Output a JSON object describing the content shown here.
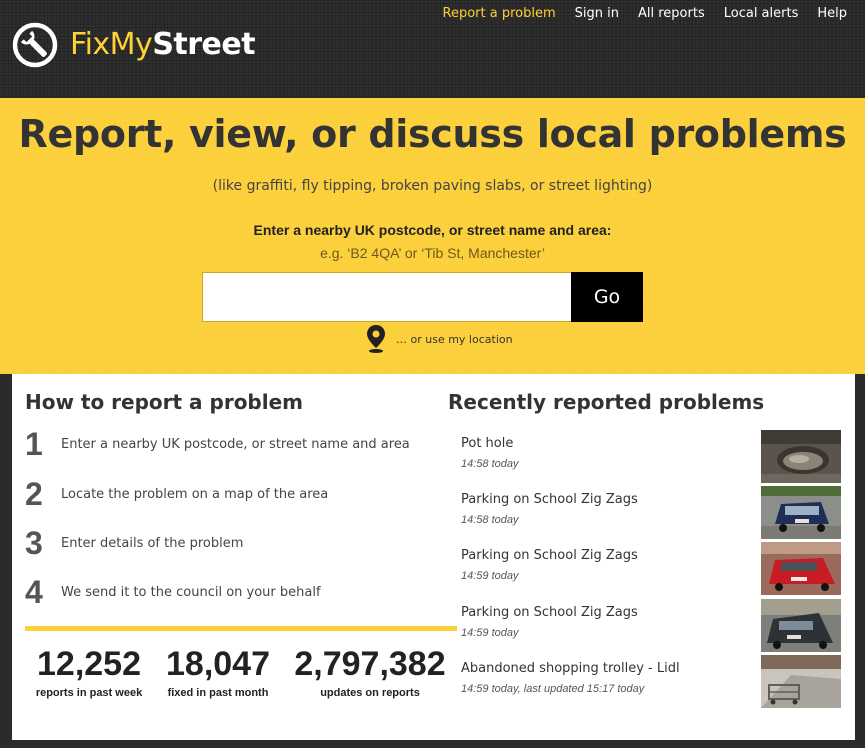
{
  "brand": {
    "fix": "FixMy",
    "street": "Street"
  },
  "nav": {
    "items": [
      {
        "label": "Report a problem",
        "active": true
      },
      {
        "label": "Sign in",
        "active": false
      },
      {
        "label": "All reports",
        "active": false
      },
      {
        "label": "Local alerts",
        "active": false
      },
      {
        "label": "Help",
        "active": false
      }
    ]
  },
  "hero": {
    "title": "Report, view, or discuss local problems",
    "subtitle": "(like graffiti, fly tipping, broken paving slabs, or street lighting)",
    "search_label": "Enter a nearby UK postcode, or street name and area:",
    "search_example": "e.g. ‘B2 4QA’ or ‘Tib St, Manchester’",
    "search_value": "",
    "go_label": "Go",
    "geolocate_label": "… or use my location"
  },
  "howto": {
    "title": "How to report a problem",
    "steps": [
      {
        "num": "1",
        "text": "Enter a nearby UK postcode, or street name and area"
      },
      {
        "num": "2",
        "text": "Locate the problem on a map of the area"
      },
      {
        "num": "3",
        "text": "Enter details of the problem"
      },
      {
        "num": "4",
        "text": "We send it to the council on your behalf"
      }
    ]
  },
  "stats": [
    {
      "value": "12,252",
      "label": "reports in past week"
    },
    {
      "value": "18,047",
      "label": "fixed in past month"
    },
    {
      "value": "2,797,382",
      "label": "updates on reports"
    }
  ],
  "recent": {
    "title": "Recently reported problems",
    "items": [
      {
        "title": "Pot hole",
        "meta": "14:58 today"
      },
      {
        "title": "Parking on School Zig Zags",
        "meta": "14:58 today"
      },
      {
        "title": "Parking on School Zig Zags",
        "meta": "14:59 today"
      },
      {
        "title": "Parking on School Zig Zags",
        "meta": "14:59 today"
      },
      {
        "title": "Abandoned shopping trolley - Lidl",
        "meta": "14:59 today, last updated 15:17 today"
      }
    ]
  },
  "colors": {
    "accent_yellow": "#fcd03a",
    "header_dark": "#2c2c2c",
    "button_black": "#000000"
  }
}
